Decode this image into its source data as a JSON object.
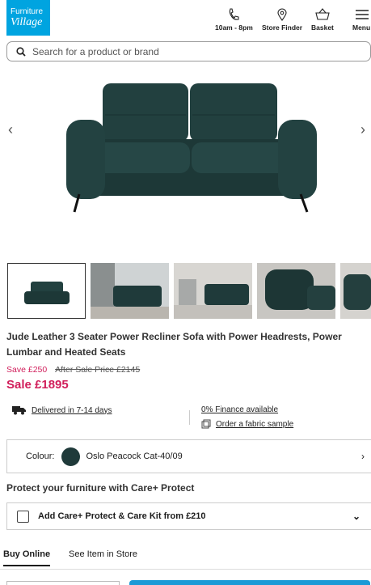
{
  "brand": {
    "logo_line1": "Furniture",
    "logo_line2": "Village",
    "color": "#00a4e0"
  },
  "header": {
    "hours": "10am - 8pm",
    "store_finder": "Store Finder",
    "basket": "Basket",
    "menu": "Menu"
  },
  "search": {
    "placeholder": "Search for a product or brand"
  },
  "gallery": {
    "prev": "‹",
    "next": "›"
  },
  "product": {
    "title": "Jude Leather 3 Seater Power Recliner Sofa with Power Headrests, Power Lumbar and Heated Seats",
    "save": "Save £250",
    "was": "After Sale Price £2145",
    "sale": "Sale £1895",
    "sale_color": "#d11e5b"
  },
  "info": {
    "delivery": "Delivered in 7-14 days",
    "finance": "0% Finance available",
    "sample": "Order a fabric sample"
  },
  "colour": {
    "label": "Colour:",
    "value": "Oslo Peacock Cat-40/09",
    "swatch": "#1f3a3a"
  },
  "protect": {
    "heading": "Protect your furniture with Care+ Protect",
    "option": "Add Care+ Protect & Care Kit from £210"
  },
  "tabs": {
    "buy": "Buy Online",
    "see": "See Item in Store"
  }
}
